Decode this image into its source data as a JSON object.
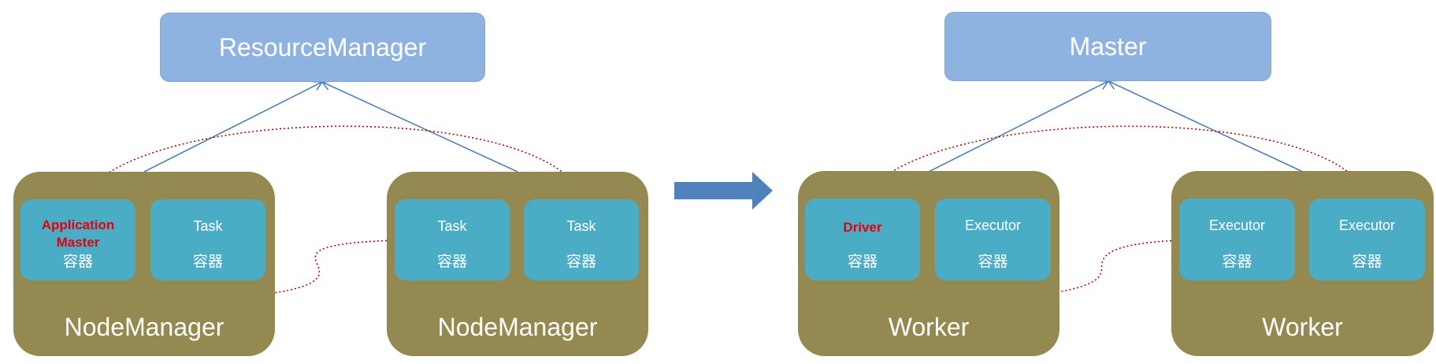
{
  "left": {
    "manager": "ResourceManager",
    "nodes": [
      {
        "label": "NodeManager",
        "containers": [
          {
            "title": "Application\nMaster",
            "sub": "容器",
            "accent": true
          },
          {
            "title": "Task",
            "sub": "容器",
            "accent": false
          }
        ]
      },
      {
        "label": "NodeManager",
        "containers": [
          {
            "title": "Task",
            "sub": "容器",
            "accent": false
          },
          {
            "title": "Task",
            "sub": "容器",
            "accent": false
          }
        ]
      }
    ]
  },
  "right": {
    "manager": "Master",
    "nodes": [
      {
        "label": "Worker",
        "containers": [
          {
            "title": "Driver",
            "sub": "容器",
            "accent": true
          },
          {
            "title": "Executor",
            "sub": "容器",
            "accent": false
          }
        ]
      },
      {
        "label": "Worker",
        "containers": [
          {
            "title": "Executor",
            "sub": "容器",
            "accent": false
          },
          {
            "title": "Executor",
            "sub": "容器",
            "accent": false
          }
        ]
      }
    ]
  },
  "colors": {
    "manager": "#8fb3e0",
    "node": "#938951",
    "container": "#4bacc6",
    "accent_text": "#e3000f",
    "solid_line": "#4f81bd",
    "dotted_line": "#c00000",
    "big_arrow": "#4f81bd"
  }
}
